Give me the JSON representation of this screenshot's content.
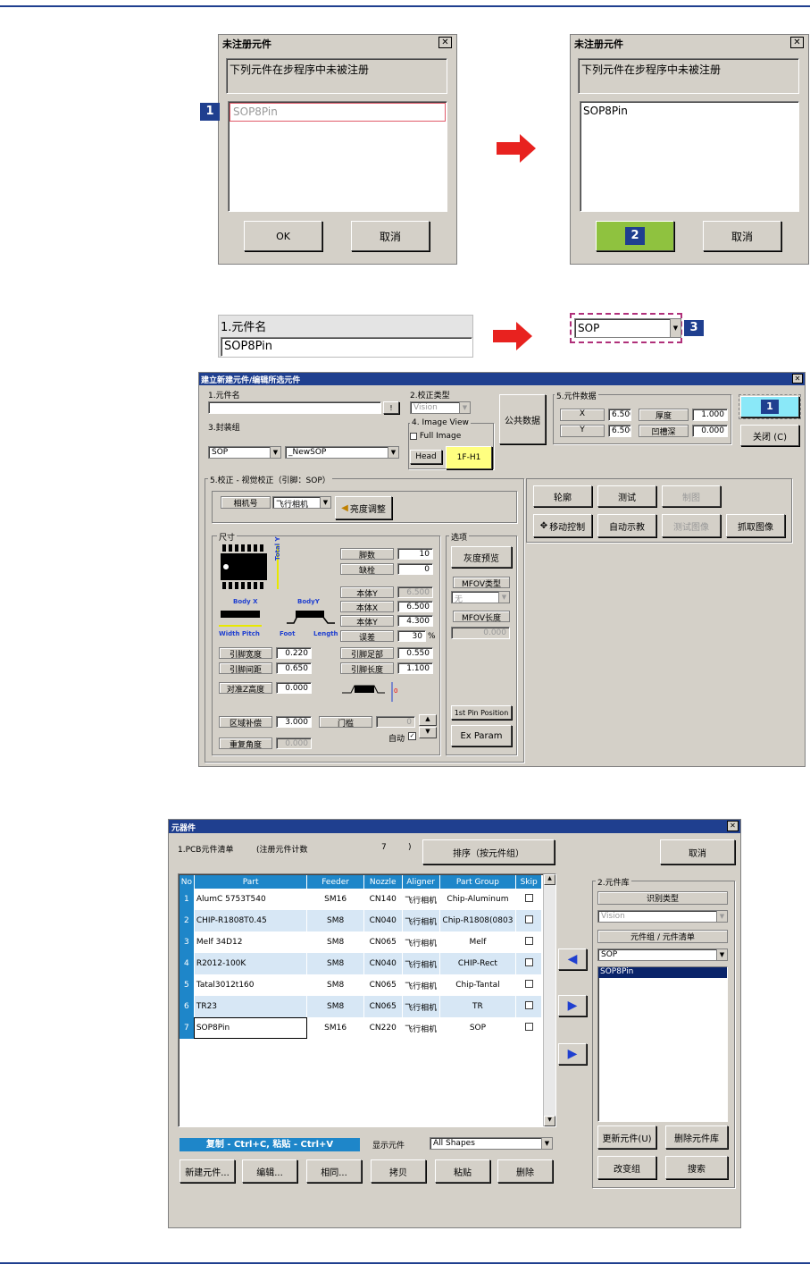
{
  "colors": {
    "accent_blue": "#1f3f8f",
    "table_header": "#1e86c9",
    "arrow_red": "#e8221f",
    "ok_green": "#8fc23f",
    "yellow": "#ffff80"
  },
  "dlg1": {
    "title": "未注册元件",
    "message": "下列元件在步程序中未被注册",
    "item": "SOP8Pin",
    "ok": "OK",
    "cancel": "取消",
    "badge": "1"
  },
  "dlg2": {
    "title": "未注册元件",
    "message": "下列元件在步程序中未被注册",
    "item": "SOP8Pin",
    "ok_badge": "2",
    "cancel": "取消"
  },
  "name_field": {
    "label": "1.元件名",
    "value": "SOP8Pin"
  },
  "combo_sop": {
    "value": "SOP",
    "badge": "3"
  },
  "editor": {
    "title": "建立新建元件/编辑所选元件",
    "name_label": "1.元件名",
    "name_btn": "!",
    "pkg_label": "3.封装组",
    "pkg_value": "SOP",
    "pkg2_value": "_NewSOP",
    "cal_label": "2.校正类型",
    "cal_value": "Vision",
    "imgview_label": "4. Image View",
    "full_image": "Full Image",
    "head_btn": "Head",
    "head_val": "1F-H1",
    "common_btn": "公共数据",
    "comp_data_label": "5.元件数据",
    "x_label": "X",
    "x_val": "6.500",
    "y_label": "Y",
    "y_val": "6.500",
    "thick_label": "厚度",
    "thick_val": "1.000",
    "groove_label": "凹槽深",
    "groove_val": "0.000",
    "badge": "1",
    "close_btn": "关闭 (C)",
    "vision_label": "5.校正 - 视觉校正（引脚：SOP）",
    "camera_label": "相机号",
    "camera_val": "飞行相机",
    "bright_btn": "亮度调整",
    "tools": [
      "轮廓",
      "测试",
      "制图",
      "移动控制",
      "自动示教",
      "测试图像",
      "抓取图像"
    ],
    "size_label": "尺寸",
    "pic": {
      "total_y": "Total Y",
      "body_x": "Body X",
      "body_y": "BodyY",
      "width_pitch": "Width  Pitch",
      "foot": "Foot",
      "length": "Length"
    },
    "fields": [
      {
        "label": "脚数",
        "value": "10"
      },
      {
        "label": "缺栓",
        "value": "0"
      },
      {
        "label": "本体Y",
        "value": "6.500"
      },
      {
        "label": "本体X",
        "value": "6.500"
      },
      {
        "label": "本体Y",
        "value": "4.300"
      },
      {
        "label": "误差",
        "value": "30"
      }
    ],
    "pct": "%",
    "lead_width": {
      "label": "引脚宽度",
      "value": "0.220"
    },
    "lead_pitch": {
      "label": "引脚间距",
      "value": "0.650"
    },
    "lead_foot": {
      "label": "引脚足部",
      "value": "0.550"
    },
    "lead_len": {
      "label": "引脚长度",
      "value": "1.100"
    },
    "z_height": {
      "label": "对准Z高度",
      "value": "0.000"
    },
    "area_comp": {
      "label": "区域补偿",
      "value": "3.000"
    },
    "threshold": {
      "label": "门槛",
      "value": "0"
    },
    "auto": "自动",
    "repeat": {
      "label": "重复角度",
      "value": "0.000"
    },
    "opt_label": "选项",
    "gray_btn": "灰度预览",
    "mfov_type": "MFOV类型",
    "mfov_type_val": "无",
    "mfov_len": "MFOV长度",
    "mfov_len_val": "0.000",
    "pin1_btn": "1st Pin Position",
    "ex_btn": "Ex Param"
  },
  "lib": {
    "title": "元器件",
    "pcb_label": "1.PCB元件清单",
    "count_label": "(注册元件计数",
    "count": "7",
    "count_close": ")",
    "sort_btn": "排序（按元件组）",
    "cancel_btn": "取消",
    "columns": [
      "No",
      "Part",
      "Feeder",
      "Nozzle",
      "Aligner",
      "Part Group",
      "Skip"
    ],
    "rows": [
      {
        "no": "1",
        "part": "AlumC 5753T540",
        "feeder": "SM16",
        "nozzle": "CN140",
        "aligner": "飞行相机",
        "group": "Chip-Aluminum"
      },
      {
        "no": "2",
        "part": "CHIP-R1808T0.45",
        "feeder": "SM8",
        "nozzle": "CN040",
        "aligner": "飞行相机",
        "group": "Chip-R1808(0803"
      },
      {
        "no": "3",
        "part": "Melf 34D12",
        "feeder": "SM8",
        "nozzle": "CN065",
        "aligner": "飞行相机",
        "group": "Melf"
      },
      {
        "no": "4",
        "part": "R2012-100K",
        "feeder": "SM8",
        "nozzle": "CN040",
        "aligner": "飞行相机",
        "group": "CHIP-Rect"
      },
      {
        "no": "5",
        "part": "Tatal3012t160",
        "feeder": "SM8",
        "nozzle": "CN065",
        "aligner": "飞行相机",
        "group": "Chip-Tantal"
      },
      {
        "no": "6",
        "part": "TR23",
        "feeder": "SM8",
        "nozzle": "CN065",
        "aligner": "飞行相机",
        "group": "TR"
      },
      {
        "no": "7",
        "part": "SOP8Pin",
        "feeder": "SM16",
        "nozzle": "CN220",
        "aligner": "飞行相机",
        "group": "SOP"
      }
    ],
    "copy_hint": "复制 - Ctrl+C, 粘贴 - Ctrl+V",
    "show_label": "显示元件",
    "show_val": "All Shapes",
    "btns": [
      "新建元件...",
      "编辑...",
      "相同...",
      "拷贝",
      "粘贴",
      "删除"
    ],
    "libpanel": "2.元件库",
    "rec_type": "识别类型",
    "rec_val": "Vision",
    "group_label": "元件组 / 元件清单",
    "group_val": "SOP",
    "list_item": "SOP8Pin",
    "update_btn": "更新元件(U)",
    "delete_btn": "删除元件库",
    "change_btn": "改变组",
    "search_btn": "搜索"
  }
}
